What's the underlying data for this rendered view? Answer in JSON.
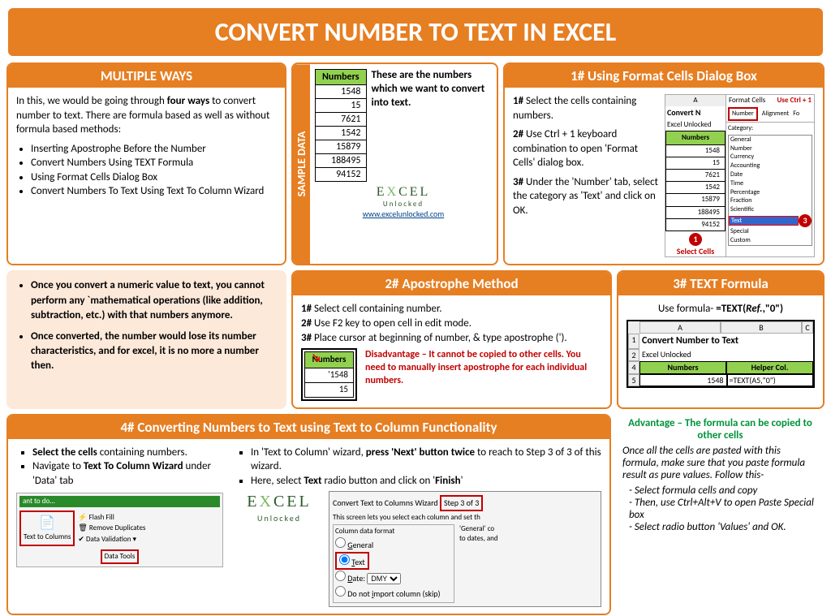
{
  "title": "CONVERT NUMBER TO TEXT IN EXCEL",
  "multipleWays": {
    "header": "MULTIPLE WAYS",
    "intro1": "In this, we would be going through ",
    "intro1b": "four ways",
    "intro2": " to convert number to text. There are formula based as well as without formula based methods:",
    "items": [
      "Inserting Apostrophe Before the Number",
      "Convert Numbers Using TEXT Formula",
      "Using Format Cells Dialog Box",
      "Convert Numbers To Text Using Text To Column Wizard"
    ]
  },
  "sample": {
    "label": "SAMPLE DATA",
    "header": "Numbers",
    "values": [
      "1548",
      "15",
      "7621",
      "1542",
      "15879",
      "188495",
      "94152"
    ],
    "caption": "These are the numbers which we want to convert into text.",
    "url": "www.excelunlocked.com",
    "logo": "EXCEL Unlocked"
  },
  "method1": {
    "header": "1# Using Format Cells Dialog Box",
    "s1b": "1#",
    "s1": " Select the cells containing numbers.",
    "s2b": "2#",
    "s2": " Use Ctrl + 1 keyboard combination to open 'Format Cells' dialog box.",
    "s3b": "3#",
    "s3": " Under the 'Number' tab, select the category as 'Text' and click on OK.",
    "imgTitle": "Convert N",
    "imgSub": "Excel Unlocked",
    "dlgTitle": "Format Cells",
    "shortcut": "Use Ctrl + 1",
    "tab1": "Number",
    "tab2": "Alignment",
    "tab3": "Fo",
    "catLabel": "Category:",
    "categories": [
      "General",
      "Number",
      "Currency",
      "Accounting",
      "Date",
      "Time",
      "Percentage",
      "Fraction",
      "Scientific",
      "Text",
      "Special",
      "Custom"
    ],
    "selectCells": "Select Cells",
    "b1": "1",
    "b3": "3"
  },
  "notes": {
    "n1a": "Once you convert a numeric value to text, you cannot perform any `mathematical operations (like addition, subtraction, etc.) with that numbers anymore.",
    "n2a": "Once converted, the number would lose its number characteristics, and for excel, it is no more a number then."
  },
  "method2": {
    "header": "2# Apostrophe Method",
    "s1b": "1#",
    "s1": " Select cell containing number.",
    "s2b": "2#",
    "s2": " Use F2 key to open cell in edit mode.",
    "s3b": "3#",
    "s3": " Place cursor at beginning of number, & type apostrophe (').",
    "miniHeader": "Numbers",
    "miniVal1": "'1548",
    "miniVal2": "15",
    "disadvantage": "Disadvantage – It cannot be copied to other cells. You need to manually insert apostrophe for each individual numbers."
  },
  "method3": {
    "header": "3# TEXT Formula",
    "formulaLabel": "Use formula-  ",
    "formula": "=TEXT(Ref.,\"0\")",
    "imgTitle": "Convert Number to Text",
    "imgSub": "Excel Unlocked",
    "col1": "Numbers",
    "col2": "Helper Col.",
    "cellA": "1548",
    "cellB": "=TEXT(A5,\"0\")",
    "advantage": "Advantage – The formula can be copied to other cells",
    "tail": "Once all the cells are pasted with this formula, make sure that you paste formula result as pure values. Follow this-",
    "steps": [
      "Select formula cells and copy",
      "Then, use Ctrl+Alt+V to open Paste Special box",
      "Select radio button 'Values' and OK."
    ]
  },
  "method4": {
    "header": "4# Converting Numbers to Text using Text to Column Functionality",
    "l1a": "Select the cells",
    "l1b": " containing numbers.",
    "l2a": "Navigate to ",
    "l2b": "Text To Column Wizard",
    "l2c": " under 'Data' tab",
    "r1a": "In 'Text to Column' wizard, ",
    "r1b": "press 'Next' button twice",
    "r1c": " to reach to Step 3 of 3 of this wizard.",
    "r2a": "Here, select ",
    "r2b": "Text",
    "r2c": " radio button and click on '",
    "r2d": "Finish",
    "r2e": "'",
    "ribbonDo": "ant to do...",
    "ribbonItems": [
      "Flash Fill",
      "Remove Duplicates",
      "Data Validation"
    ],
    "ribbonMain": "Text to Columns",
    "ribbonGroup": "Data Tools",
    "wizTitle": "Convert Text to Columns Wizard ",
    "wizStep": "Step 3 of 3",
    "wizDesc": "This screen lets you select each column and set th",
    "wizSection": "Column data format",
    "optGeneral": "General",
    "optText": "Text",
    "optDate": "Date:",
    "optDateVal": "DMY",
    "optSkip": "Do not import column (skip)",
    "wizHint": "'General' co\nto dates, and"
  }
}
